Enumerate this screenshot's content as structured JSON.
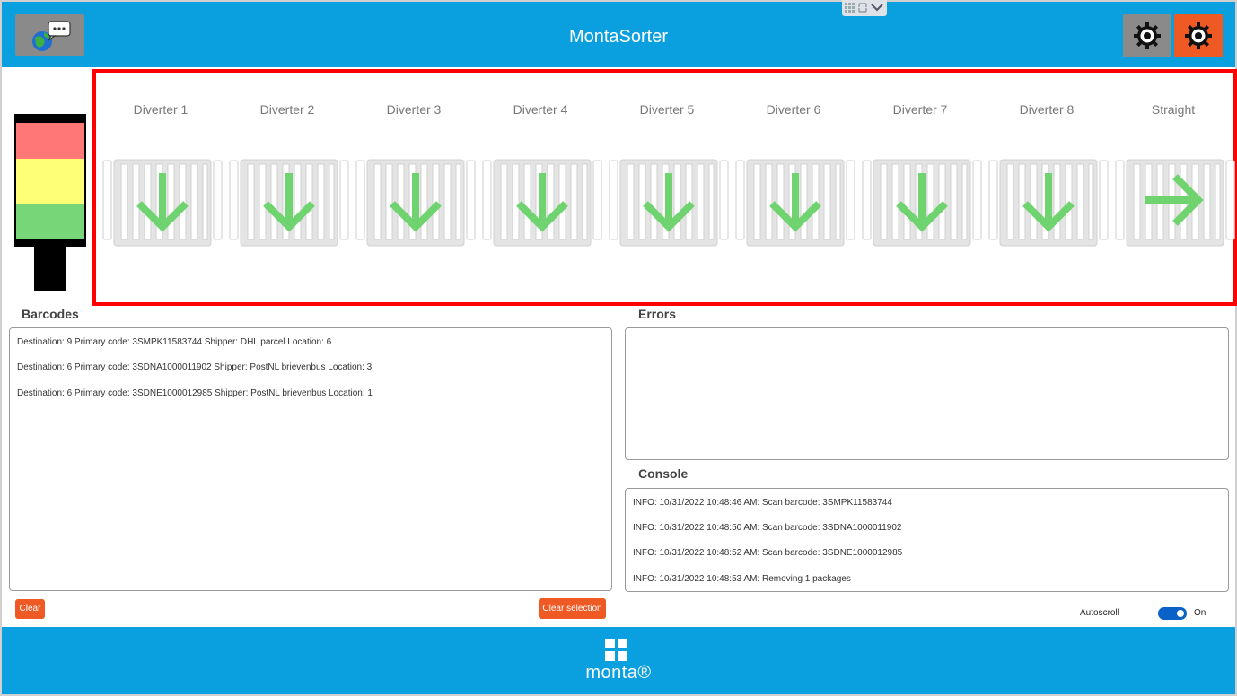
{
  "header": {
    "title": "MontaSorter"
  },
  "diverters": [
    {
      "label": "Diverter 1",
      "direction": "down"
    },
    {
      "label": "Diverter 2",
      "direction": "down"
    },
    {
      "label": "Diverter 3",
      "direction": "down"
    },
    {
      "label": "Diverter 4",
      "direction": "down"
    },
    {
      "label": "Diverter 5",
      "direction": "down"
    },
    {
      "label": "Diverter 6",
      "direction": "down"
    },
    {
      "label": "Diverter 7",
      "direction": "down"
    },
    {
      "label": "Diverter 8",
      "direction": "down"
    },
    {
      "label": "Straight",
      "direction": "right"
    }
  ],
  "barcodes": {
    "title": "Barcodes",
    "lines": [
      "Destination: 9 Primary code: 3SMPK11583744 Shipper: DHL parcel Location: 6",
      "Destination: 6 Primary code: 3SDNA1000011902 Shipper: PostNL brievenbus Location: 3",
      "Destination: 6 Primary code: 3SDNE1000012985 Shipper: PostNL brievenbus Location: 1"
    ],
    "clear_label": "Clear",
    "clear_selection_label": "Clear selection"
  },
  "errors": {
    "title": "Errors"
  },
  "console": {
    "title": "Console",
    "lines": [
      "INFO: 10/31/2022 10:48:46 AM: Scan barcode: 3SMPK11583744",
      "INFO: 10/31/2022 10:48:50 AM: Scan barcode: 3SDNA1000011902",
      "INFO: 10/31/2022 10:48:52 AM: Scan barcode: 3SDNE1000012985",
      "INFO: 10/31/2022 10:48:53 AM: Removing 1 packages"
    ]
  },
  "autoscroll": {
    "label": "Autoscroll",
    "state": "On"
  },
  "footer": {
    "logo_text": "monta®"
  },
  "colors": {
    "brand_blue": "#0a9fdf",
    "accent_orange": "#ef5a24",
    "arrow_green": "#6fd36f",
    "highlight_red": "#ff0000"
  },
  "icons": {
    "language": "globe-chat-icon",
    "settings": "gear-icon",
    "logo": "grid-logo-icon"
  }
}
